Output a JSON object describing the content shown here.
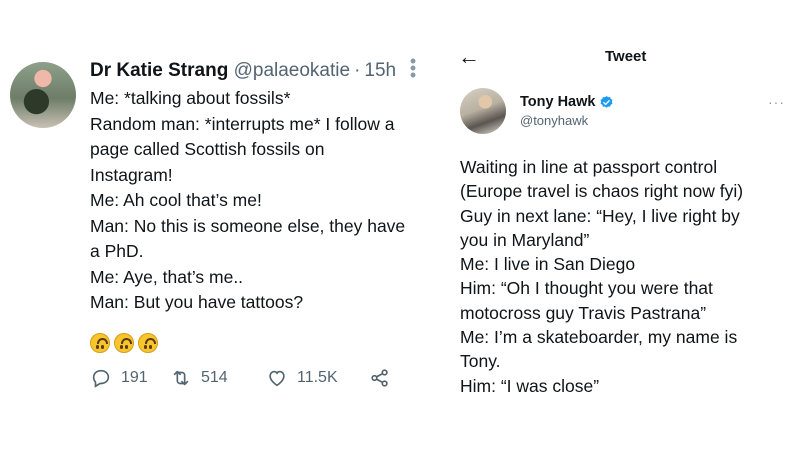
{
  "left_tweet": {
    "name": "Dr Katie Strang",
    "handle": "@palaeokatie",
    "separator": "·",
    "time": "15h",
    "more_icon": "⋮",
    "lines": [
      "Me: *talking about fossils*",
      "Random man: *interrupts me* I follow a",
      "page called Scottish fossils on",
      "Instagram!",
      "Me: Ah cool that’s me!",
      "Man: No this is someone else, they have",
      "a PhD.",
      "Me: Aye, that’s me..",
      "Man: But you have tattoos?"
    ],
    "emojis": [
      "upside-down-face",
      "upside-down-face",
      "upside-down-face"
    ],
    "stats": {
      "replies": "191",
      "retweets": "514",
      "likes": "11.5K"
    }
  },
  "right_tweet": {
    "back_icon": "←",
    "title": "Tweet",
    "name": "Tony Hawk",
    "handle": "@tonyhawk",
    "more_icon": "···",
    "lines": [
      "Waiting in line at passport control",
      "(Europe travel is chaos right now fyi)",
      "Guy in next lane: “Hey, I live right by",
      "you in Maryland”",
      "Me: I live in San Diego",
      "Him: “Oh I thought you were that",
      "motocross guy Travis Pastrana”",
      "Me: I’m a skateboarder, my name is",
      "Tony.",
      "Him: “I was close”"
    ]
  },
  "colors": {
    "text": "#0f1419",
    "muted": "#536471",
    "verified": "#1d9bf0",
    "emoji": "#f7c52c"
  }
}
